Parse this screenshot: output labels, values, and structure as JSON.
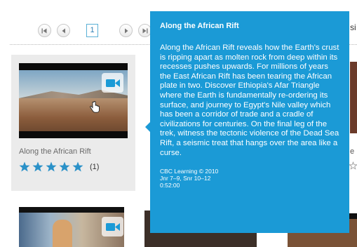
{
  "pager": {
    "current_page": "1",
    "first_label": "first-page",
    "prev_label": "previous-page",
    "next_label": "next-page",
    "last_label": "last-page",
    "edge_text": "si"
  },
  "card": {
    "title": "Along the African Rift",
    "rating": 5,
    "rating_count": "(1)",
    "star_color": "#2a91c8"
  },
  "right_column": {
    "edge_text": "e"
  },
  "tooltip": {
    "title": "Along the African Rift",
    "description": "Along the African Rift reveals how the Earth's crust is ripping apart as molten rock from deep within its recesses pushes upwards. For millions of years the East African Rift has been tearing the African plate in two. Discover Ethiopia's Afar Triangle where the Earth is fundamentally re-ordering its surface, and journey to Egypt's Nile valley which has been a corridor of trade and a cradle of civilizations for centuries. On the final leg of the trek, witness the tectonic violence of the Dead Sea Rift, a seismic treat that hangs over the area like a curse.",
    "publisher": "CBC Learning © 2010",
    "grades": "Jnr 7–9, Snr 10–12",
    "duration": "0:52:00",
    "background": "#1b9ad6"
  }
}
